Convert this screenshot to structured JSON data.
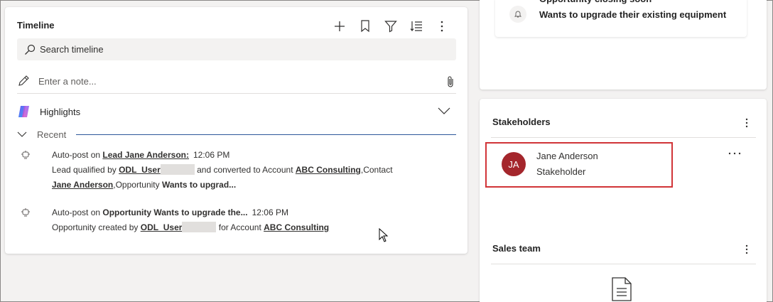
{
  "timeline": {
    "title": "Timeline",
    "search_placeholder": "Search timeline",
    "note_placeholder": "Enter a note...",
    "highlights_label": "Highlights",
    "recent_label": "Recent",
    "posts": [
      {
        "prefix": "Auto-post on ",
        "subject": "Lead Jane Anderson:",
        "time": "12:06 PM",
        "line2_a": "Lead qualified by ",
        "user": "ODL_User",
        "line2_b": " and converted to Account ",
        "account": "ABC Consulting",
        "line2_c": ",Contact",
        "contact": "Jane Anderson",
        "line3_a": ",Opportunity ",
        "opportunity": "Wants to upgrad..."
      },
      {
        "prefix": "Auto-post on ",
        "subject": "Opportunity Wants to upgrade the...",
        "time": "12:06 PM",
        "line2_a": "Opportunity created by ",
        "user": "ODL_User",
        "line2_b": " for Account ",
        "account": "ABC Consulting"
      }
    ]
  },
  "opportunity_card": {
    "title": "Opportunity closing soon",
    "text": "Wants to upgrade their existing equipment"
  },
  "stakeholders": {
    "title": "Stakeholders",
    "items": [
      {
        "initials": "JA",
        "name": "Jane Anderson",
        "role": "Stakeholder"
      }
    ]
  },
  "sales_team": {
    "title": "Sales team"
  },
  "colors": {
    "avatar": "#a4262c",
    "highlight_border": "#d13438",
    "recent_line": "#2b579a"
  }
}
